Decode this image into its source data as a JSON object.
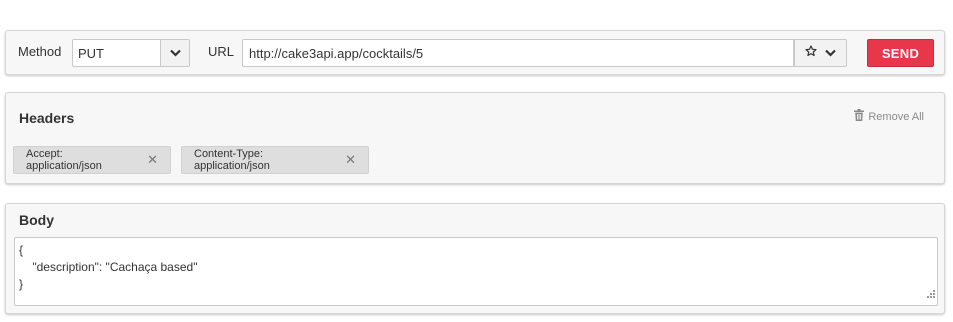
{
  "request": {
    "method_label": "Method",
    "method_value": "PUT",
    "url_label": "URL",
    "url_value": "http://cake3api.app/cocktails/5",
    "send_label": "SEND",
    "icons": [
      "star-icon",
      "chevron-down-icon"
    ]
  },
  "headers": {
    "title": "Headers",
    "remove_all_label": "Remove All",
    "items": [
      {
        "label": "Accept: application/json"
      },
      {
        "label": "Content-Type: application/json"
      }
    ]
  },
  "body": {
    "title": "Body",
    "lines": [
      "{",
      "    \"description\": \"Cachaça based\"",
      "}"
    ]
  },
  "colors": {
    "send_button": "#e8374a",
    "panel_background": "#f7f7f7",
    "tag_background": "#dedede"
  }
}
